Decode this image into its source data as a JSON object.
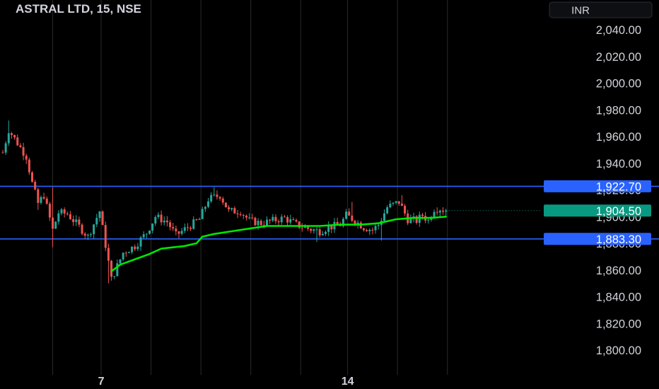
{
  "header": {
    "title": "ASTRAL LTD, 15, NSE",
    "currency": "INR"
  },
  "colors": {
    "background": "#000000",
    "up": "#26a69a",
    "down": "#ef5350",
    "level_line": "#2962ff",
    "avg_line": "#00e600",
    "last_price": "#089981",
    "session_separator": "#2a2a2a",
    "text": "#d1d4dc"
  },
  "chart_data": {
    "type": "candlestick",
    "y_axis": {
      "min": 1790,
      "max": 2050,
      "ticks": [
        2040,
        2020,
        2000,
        1980,
        1960,
        1940,
        1920,
        1900,
        1880,
        1860,
        1840,
        1820,
        1800
      ],
      "tick_labels": [
        "2,040.00",
        "2,020.00",
        "2,000.00",
        "1,980.00",
        "1,960.00",
        "1,940.00",
        "1,920.00",
        "1,900.00",
        "1,880.00",
        "1,860.00",
        "1,840.00",
        "1,820.00",
        "1,800.00"
      ]
    },
    "x_axis": {
      "labels": [
        {
          "text": "7",
          "bar": 33.5
        },
        {
          "text": "14",
          "bar": 117.5
        }
      ],
      "session_starts": [
        17,
        33.5,
        50.5,
        67.5,
        84.5,
        101.5,
        117.5,
        134.5,
        151.5
      ]
    },
    "horizontal_levels": [
      {
        "value": 1922.7,
        "label": "1,922.70"
      },
      {
        "value": 1883.3,
        "label": "1,883.30"
      }
    ],
    "last_price": {
      "value": 1904.5,
      "label": "1,904.50"
    },
    "candles": {
      "bar_count": 152,
      "open_first": 1948,
      "close_last": 1904.5,
      "key_points": [
        [
          0,
          1948
        ],
        [
          2,
          1965
        ],
        [
          5,
          1955
        ],
        [
          8,
          1945
        ],
        [
          10,
          1925
        ],
        [
          12,
          1910
        ],
        [
          14,
          1916
        ],
        [
          17,
          1890
        ],
        [
          19,
          1903
        ],
        [
          22,
          1902
        ],
        [
          25,
          1895
        ],
        [
          29,
          1885
        ],
        [
          33,
          1904
        ],
        [
          36,
          1866
        ],
        [
          37,
          1853
        ],
        [
          41,
          1873
        ],
        [
          45,
          1878
        ],
        [
          49,
          1888
        ],
        [
          52,
          1900
        ],
        [
          56,
          1896
        ],
        [
          59,
          1886
        ],
        [
          63,
          1892
        ],
        [
          67,
          1898
        ],
        [
          70,
          1913
        ],
        [
          74,
          1916
        ],
        [
          77,
          1904
        ],
        [
          81,
          1904
        ],
        [
          84,
          1897
        ],
        [
          88,
          1895
        ],
        [
          92,
          1897
        ],
        [
          96,
          1899
        ],
        [
          100,
          1894
        ],
        [
          104,
          1891
        ],
        [
          108,
          1889
        ],
        [
          111,
          1892
        ],
        [
          115,
          1894
        ],
        [
          117,
          1901
        ],
        [
          120,
          1897
        ],
        [
          123,
          1892
        ],
        [
          126,
          1890
        ],
        [
          128,
          1894
        ],
        [
          131,
          1907
        ],
        [
          135,
          1911
        ],
        [
          138,
          1898
        ],
        [
          141,
          1897
        ],
        [
          143,
          1901
        ],
        [
          145,
          1897
        ],
        [
          147,
          1906
        ],
        [
          149,
          1906
        ],
        [
          151,
          1904.5
        ]
      ],
      "spikes": [
        {
          "bar": 2,
          "high": 1972
        },
        {
          "bar": 12,
          "low": 1905
        },
        {
          "bar": 17,
          "low": 1877,
          "high": 1922
        },
        {
          "bar": 36,
          "low": 1850
        },
        {
          "bar": 37,
          "low": 1852
        },
        {
          "bar": 72,
          "high": 1922
        },
        {
          "bar": 107,
          "low": 1881
        },
        {
          "bar": 129,
          "low": 1882
        },
        {
          "bar": 136,
          "high": 1916
        },
        {
          "bar": 119,
          "high": 1911
        }
      ]
    },
    "avg_line": [
      [
        37,
        1859
      ],
      [
        40,
        1864
      ],
      [
        45,
        1868
      ],
      [
        50,
        1872
      ],
      [
        54,
        1876
      ],
      [
        58,
        1877
      ],
      [
        62,
        1878
      ],
      [
        66,
        1880
      ],
      [
        68,
        1885
      ],
      [
        72,
        1887
      ],
      [
        78,
        1889
      ],
      [
        84,
        1891
      ],
      [
        90,
        1893
      ],
      [
        96,
        1893
      ],
      [
        102,
        1893
      ],
      [
        108,
        1893
      ],
      [
        115,
        1894
      ],
      [
        122,
        1894
      ],
      [
        128,
        1895
      ],
      [
        134,
        1898
      ],
      [
        140,
        1899
      ],
      [
        146,
        1899
      ],
      [
        151,
        1900
      ]
    ]
  }
}
